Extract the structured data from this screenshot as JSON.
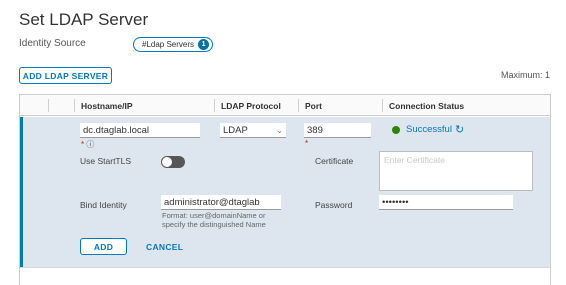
{
  "page": {
    "title": "Set LDAP Server",
    "identity_source_label": "Identity Source",
    "identity_source_value": "#Ldap Servers",
    "identity_source_count": "1",
    "add_server_label": "ADD LDAP SERVER",
    "maximum_label": "Maximum: 1"
  },
  "grid": {
    "columns": [
      "Hostname/IP",
      "LDAP Protocol",
      "Port",
      "Connection Status"
    ]
  },
  "form": {
    "hostname": "dc.dtaglab.local",
    "protocol": "LDAP",
    "port": "389",
    "status": "Successful",
    "required_mark": "*",
    "starttls_label": "Use StartTLS",
    "certificate_label": "Certificate",
    "certificate_placeholder": "Enter Certificate",
    "bind_identity_label": "Bind Identity",
    "bind_identity_value": "administrator@dtaglab",
    "bind_hint": "Format: user@domainName or specify the distinguished Name",
    "password_label": "Password",
    "password_value": "••••••••",
    "add_label": "ADD",
    "cancel_label": "CANCEL"
  },
  "colors": {
    "accent": "#0079b8",
    "success": "#2f8400",
    "edit_row_bg": "#dde6ee"
  },
  "icons": {
    "info": "info-icon",
    "refresh": "refresh-icon",
    "chevron": "chevron-down-icon"
  }
}
